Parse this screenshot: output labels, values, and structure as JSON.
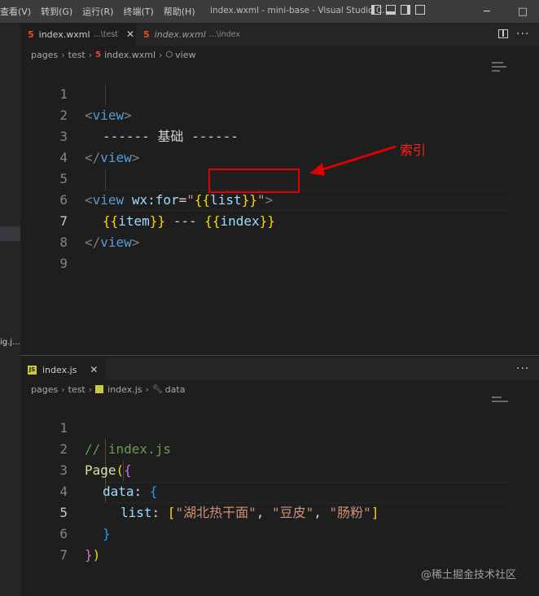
{
  "titlebar": {
    "menus": [
      "查看(V)",
      "转到(G)",
      "运行(R)",
      "终端(T)",
      "帮助(H)"
    ],
    "window_title": "index.wxml - mini-base - Visual Studio C..."
  },
  "activity": {
    "partial_label": "ig.j..."
  },
  "top_editor": {
    "tabs": [
      {
        "name": "index.wxml",
        "path": "...\\test",
        "active": true
      },
      {
        "name": "index.wxml",
        "path": "...\\index",
        "active": false
      }
    ],
    "breadcrumb": [
      "pages",
      "test",
      "index.wxml",
      "view"
    ],
    "line_numbers": [
      "1",
      "2",
      "3",
      "4",
      "5",
      "6",
      "7",
      "8",
      "9"
    ]
  },
  "top_code": {
    "l1_open": "<",
    "l1_tag": "view",
    "l1_close": ">",
    "l2_text": "------ 基础 ------",
    "l3_open": "</",
    "l3_tag": "view",
    "l3_close": ">",
    "l5_open": "<",
    "l5_tag": "view",
    "l5_attr": "wx:for",
    "l5_eq": "=",
    "l5_q1": "\"",
    "l5_mopen": "{{",
    "l5_var": "list",
    "l5_mclose": "}}",
    "l5_q2": "\"",
    "l5_close": ">",
    "l6_mopen1": "{{",
    "l6_var1": "item",
    "l6_mclose1": "}}",
    "l6_mid": " --- ",
    "l6_mopen2": "{{",
    "l6_var2": "index",
    "l6_mclose2": "}}",
    "l7_open": "</",
    "l7_tag": "view",
    "l7_close": ">"
  },
  "annotation": {
    "label": "索引",
    "color": "#ff2020"
  },
  "bottom_editor": {
    "tab": {
      "name": "index.js"
    },
    "breadcrumb": [
      "pages",
      "test",
      "index.js",
      "data"
    ],
    "line_numbers": [
      "1",
      "2",
      "3",
      "4",
      "5",
      "6",
      "7"
    ]
  },
  "bottom_code": {
    "l1": "// index.js",
    "l2_fn": "Page",
    "l2_p": "(",
    "l2_b": "{",
    "l3_key": "data",
    "l3_colon": ": ",
    "l3_b": "{",
    "l4_key": "list",
    "l4_colon": ": ",
    "l4_open": "[",
    "l4_s1": "\"湖北热干面\"",
    "l4_c1": ", ",
    "l4_s2": "\"豆皮\"",
    "l4_c2": ", ",
    "l4_s3": "\"肠粉\"",
    "l4_close": "]",
    "l5_b": "}",
    "l6_b": "}",
    "l6_p": ")"
  },
  "watermark": "@稀土掘金技术社区",
  "colors": {
    "background": "#1e1e1e",
    "tag": "#569cd6",
    "string": "#ce9178",
    "mustache": "#ffd700"
  }
}
